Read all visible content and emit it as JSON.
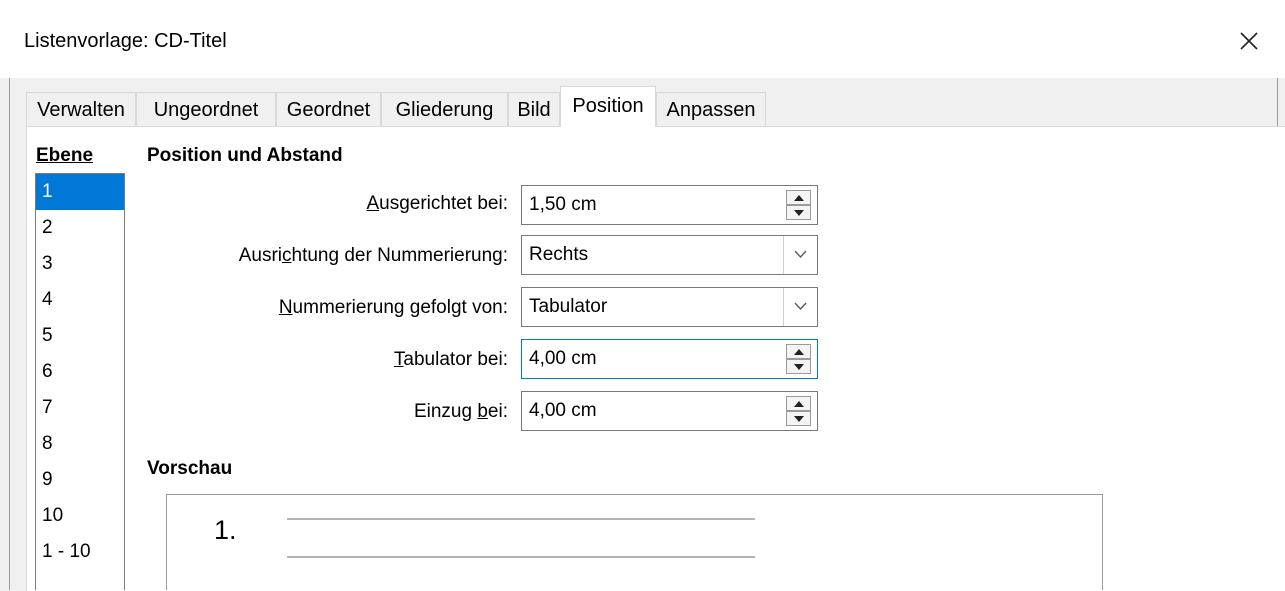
{
  "window": {
    "title": "Listenvorlage: CD-Titel",
    "close_icon": "close-icon"
  },
  "tabs": [
    {
      "label": "Verwalten",
      "active": false
    },
    {
      "label": "Ungeordnet",
      "active": false
    },
    {
      "label": "Geordnet",
      "active": false
    },
    {
      "label": "Gliederung",
      "active": false
    },
    {
      "label": "Bild",
      "active": false
    },
    {
      "label": "Position",
      "active": true
    },
    {
      "label": "Anpassen",
      "active": false
    }
  ],
  "levels": {
    "heading": "Ebene",
    "items": [
      "1",
      "2",
      "3",
      "4",
      "5",
      "6",
      "7",
      "8",
      "9",
      "10",
      "1 - 10"
    ],
    "selected": "1"
  },
  "position": {
    "heading": "Position und Abstand",
    "aligned_at": {
      "label_pre": "",
      "label_key": "A",
      "label_post": "usgerichtet bei:",
      "value": "1,50 cm"
    },
    "numbering_alignment": {
      "label_pre": "Ausri",
      "label_key": "c",
      "label_post": "htung der Nummerierung:",
      "value": "Rechts"
    },
    "numbering_followed_by": {
      "label_pre": "",
      "label_key": "N",
      "label_post": "ummerierung gefolgt von:",
      "value": "Tabulator"
    },
    "tab_stop_at": {
      "label_pre": "",
      "label_key": "T",
      "label_post": "abulator bei:",
      "value": "4,00 cm"
    },
    "indent_at": {
      "label_pre": "Einzug ",
      "label_key": "b",
      "label_post": "ei:",
      "value": "4,00 cm"
    }
  },
  "preview": {
    "heading": "Vorschau",
    "number": "1."
  },
  "colors": {
    "accent": "#0078d7",
    "background": "#f0f0f0"
  }
}
